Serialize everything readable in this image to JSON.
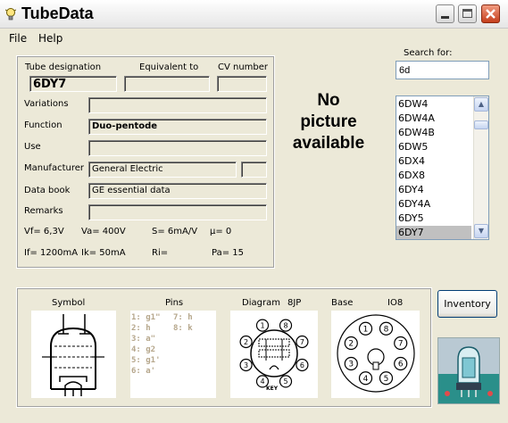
{
  "window": {
    "title": "TubeData"
  },
  "menu": {
    "file": "File",
    "help": "Help"
  },
  "tube": {
    "designation_label": "Tube designation",
    "equivalent_label": "Equivalent to",
    "cv_label": "CV number",
    "designation": "6DY7",
    "equivalent": "",
    "cv_number": "",
    "variations_label": "Variations",
    "variations": "",
    "function_label": "Function",
    "function": "Duo-pentode",
    "use_label": "Use",
    "use": "",
    "manufacturer_label": "Manufacturer",
    "manufacturer": "General Electric",
    "manufacturer_extra": "",
    "databook_label": "Data book",
    "databook": "GE essential data",
    "remarks_label": "Remarks",
    "remarks": ""
  },
  "params": {
    "vf": "Vf= 6,3V",
    "va": "Va=  400V",
    "s": "S= 6mA/V",
    "mu": "µ=    0",
    "if": "If= 1200mA",
    "ik": "Ik=  50mA",
    "ri": "Ri=",
    "pa": "Pa= 15"
  },
  "picture": {
    "line1": "No",
    "line2": "picture",
    "line3": "available"
  },
  "search": {
    "label": "Search for:",
    "value": "6d",
    "results": [
      "6DW4",
      "6DW4A",
      "6DW4B",
      "6DW5",
      "6DX4",
      "6DX8",
      "6DY4",
      "6DY4A",
      "6DY5",
      "6DY7"
    ],
    "selected": "6DY7"
  },
  "bottom": {
    "symbol_label": "Symbol",
    "pins_label": "Pins",
    "diagram_label": "Diagram",
    "diagram_code": "8JP",
    "base_label": "Base",
    "base_code": "IO8",
    "pins_col1": [
      "1: g1\"",
      "2: h",
      "3: a\"",
      "4: g2",
      "5: g1'",
      "6: a'"
    ],
    "pins_col2": [
      "7: h",
      "8: k"
    ],
    "diagram_pin_numbers": [
      "1",
      "2",
      "3",
      "4",
      "5",
      "6",
      "7",
      "8"
    ],
    "key_text": "KEY"
  },
  "inventory_button": "Inventory",
  "colors": {
    "list_selected": "#c0c0c0",
    "close_button": "#c53f1c",
    "pins_text": "#b6a78c"
  }
}
